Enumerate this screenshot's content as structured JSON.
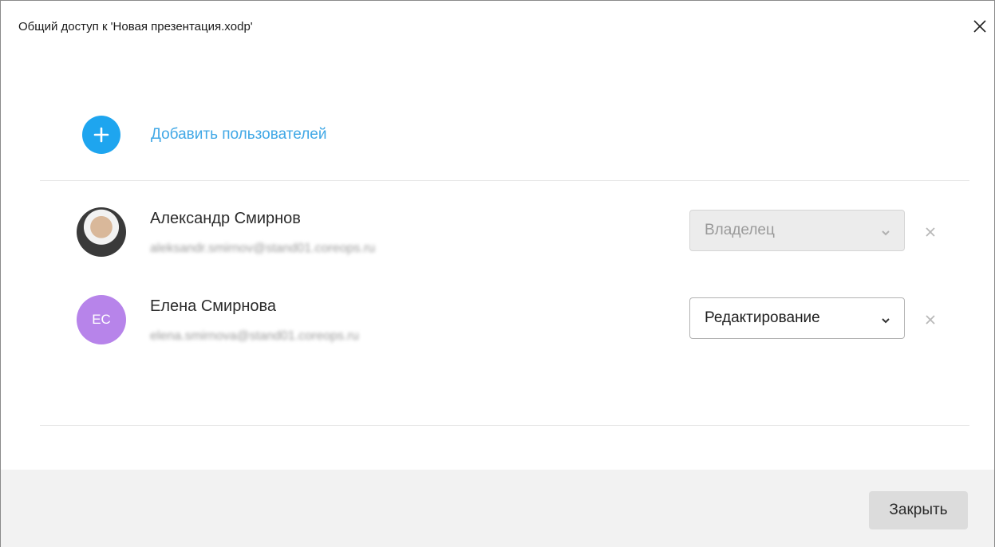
{
  "dialog": {
    "title": "Общий доступ к 'Новая презентация.xodp'",
    "close_icon": "close-icon"
  },
  "add_users": {
    "label": "Добавить пользователей",
    "icon": "plus-icon",
    "accent_color": "#1ea5ef"
  },
  "users": [
    {
      "name": "Александр Смирнов",
      "email": "aleksandr.smirnov@stand01.coreops.ru",
      "avatar": "photo",
      "role": "Владелец",
      "role_disabled": true
    },
    {
      "name": "Елена Смирнова",
      "email": "elena.smirnova@stand01.coreops.ru",
      "avatar_initials": "ЕС",
      "avatar_color": "#b784ea",
      "role": "Редактирование",
      "role_disabled": false
    }
  ],
  "footer": {
    "close_label": "Закрыть"
  }
}
